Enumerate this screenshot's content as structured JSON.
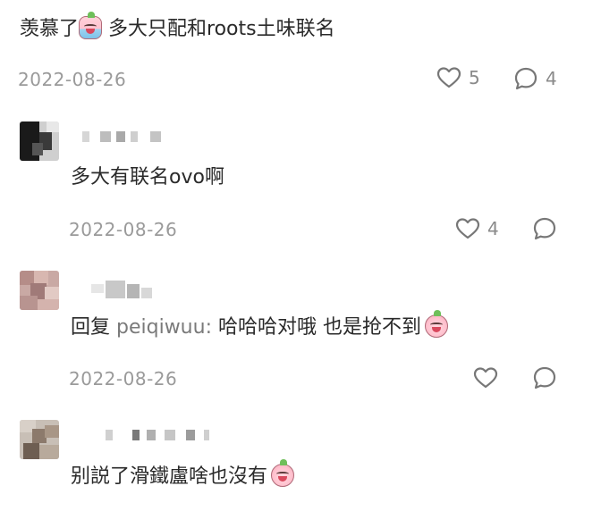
{
  "top_comment": {
    "text_before": "羡慕了",
    "emoji_1": "crying-bathing-emoji",
    "text_after": " 多大只配和roots土味联名",
    "date": "2022-08-26",
    "likes": "5",
    "replies": "4"
  },
  "replies": [
    {
      "text": "多大有联名ovo啊",
      "date": "2022-08-26",
      "likes": "4"
    },
    {
      "reply_prefix": "回复 ",
      "mention": "peiqiwuu:",
      "text": " 哈哈哈对哦 也是抢不到",
      "emoji": "crying-face-emoji",
      "date": "2022-08-26"
    },
    {
      "text": "别説了滑鐵盧啥也沒有",
      "emoji": "crying-face-emoji"
    }
  ],
  "icons": {
    "like": "heart-outline-icon",
    "comment": "speech-bubble-icon"
  },
  "colors": {
    "text": "#2a2a2a",
    "meta": "#9a9a9a",
    "icon": "#777777"
  }
}
